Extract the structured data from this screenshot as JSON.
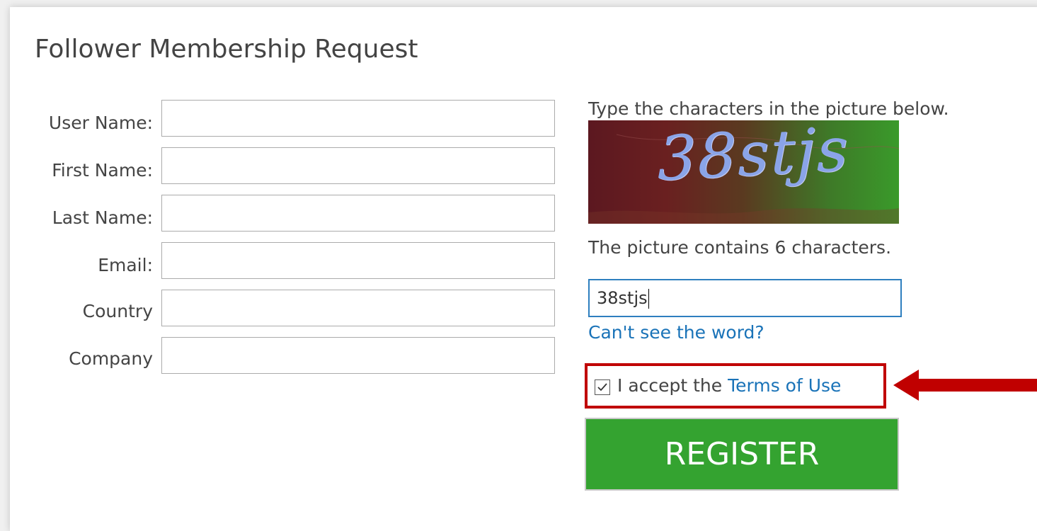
{
  "form": {
    "title": "Follower Membership Request",
    "fields": [
      {
        "label": "User Name:",
        "value": ""
      },
      {
        "label": "First Name:",
        "value": ""
      },
      {
        "label": "Last Name:",
        "value": ""
      },
      {
        "label": "Email:",
        "value": ""
      },
      {
        "label": "Country",
        "value": ""
      },
      {
        "label": "Company",
        "value": ""
      }
    ]
  },
  "captcha": {
    "instruction": "Type the characters in the picture below.",
    "image_text": "38stjs",
    "count_text": "The picture contains 6 characters.",
    "input_value": "38stjs",
    "cant_see_link": "Can't see the word?"
  },
  "terms": {
    "checked": true,
    "prefix": "I accept the ",
    "link": "Terms of Use"
  },
  "register_label": "REGISTER",
  "colors": {
    "register_bg": "#34a330",
    "link": "#1a73b8",
    "highlight": "#c00000",
    "input_focus_border": "#2e7fbf"
  },
  "icons": {
    "checkbox": "checkmark-icon",
    "annotation": "arrow-left-icon"
  }
}
